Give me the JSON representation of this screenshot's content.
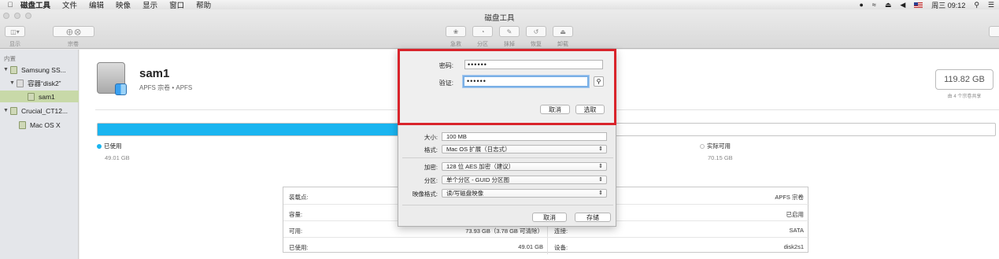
{
  "menubar": {
    "apple": "",
    "items": [
      "磁盘工具",
      "文件",
      "编辑",
      "映像",
      "显示",
      "窗口",
      "帮助"
    ],
    "clock": "周三 09:12",
    "icons": [
      "qq-icon",
      "wifi-icon",
      "eject-icon",
      "volume-icon",
      "flag-icon",
      "search-icon",
      "list-icon"
    ]
  },
  "window": {
    "title": "磁盘工具",
    "toolbar": {
      "display_label": "显示",
      "volume_label": "宗卷",
      "buttons": [
        {
          "label": "急救",
          "icon": "stethoscope-icon"
        },
        {
          "label": "分区",
          "icon": "pie-icon"
        },
        {
          "label": "抹掉",
          "icon": "erase-icon"
        },
        {
          "label": "恢复",
          "icon": "restore-icon"
        },
        {
          "label": "卸载",
          "icon": "eject-icon"
        }
      ]
    }
  },
  "sidebar": {
    "header": "内置",
    "items": [
      {
        "label": "Samsung SS...",
        "level": 0,
        "expanded": true
      },
      {
        "label": "容器“disk2”",
        "level": 1,
        "expanded": true
      },
      {
        "label": "sam1",
        "level": 2,
        "selected": true
      },
      {
        "label": "Crucial_CT12...",
        "level": 0,
        "expanded": true
      },
      {
        "label": "Mac OS X",
        "level": 1
      }
    ]
  },
  "volume": {
    "name": "sam1",
    "subtitle": "APFS 宗卷 • APFS",
    "capacity": "119.82 GB",
    "capacity_sub": "由 4 个宗卷共享",
    "used_label": "已使用",
    "used_value": "49.01 GB",
    "used_fraction": 0.409,
    "free_label": "实际可用",
    "free_value": "70.15 GB",
    "used_color": "#1ab5f0"
  },
  "info": {
    "rows": [
      {
        "k": "装载点:",
        "v": "",
        "k2": "",
        "v2": "APFS 宗卷"
      },
      {
        "k": "容量:",
        "v": "",
        "k2": "",
        "v2": "已启用"
      },
      {
        "k": "可用:",
        "v": "73.93 GB（3.78 GB 可清除）",
        "k2": "连接:",
        "v2": "SATA"
      },
      {
        "k": "已使用:",
        "v": "49.01 GB",
        "k2": "设备:",
        "v2": "disk2s1"
      }
    ]
  },
  "image_sheet": {
    "size_label": "大小:",
    "size_value": "100 MB",
    "format_label": "格式:",
    "format_value": "Mac OS 扩展（日志式）",
    "encryption_label": "加密:",
    "encryption_value": "128 位 AES 加密（建议）",
    "partition_label": "分区:",
    "partition_value": "单个分区 - GUID 分区图",
    "image_format_label": "映像格式:",
    "image_format_value": "读/写磁盘映像",
    "cancel": "取消",
    "save": "存储"
  },
  "password_dialog": {
    "password_label": "密码:",
    "password_value": "••••••",
    "verify_label": "验证:",
    "verify_value": "••••••",
    "cancel": "取消",
    "choose": "选取",
    "highlight_color": "#d9242b"
  }
}
